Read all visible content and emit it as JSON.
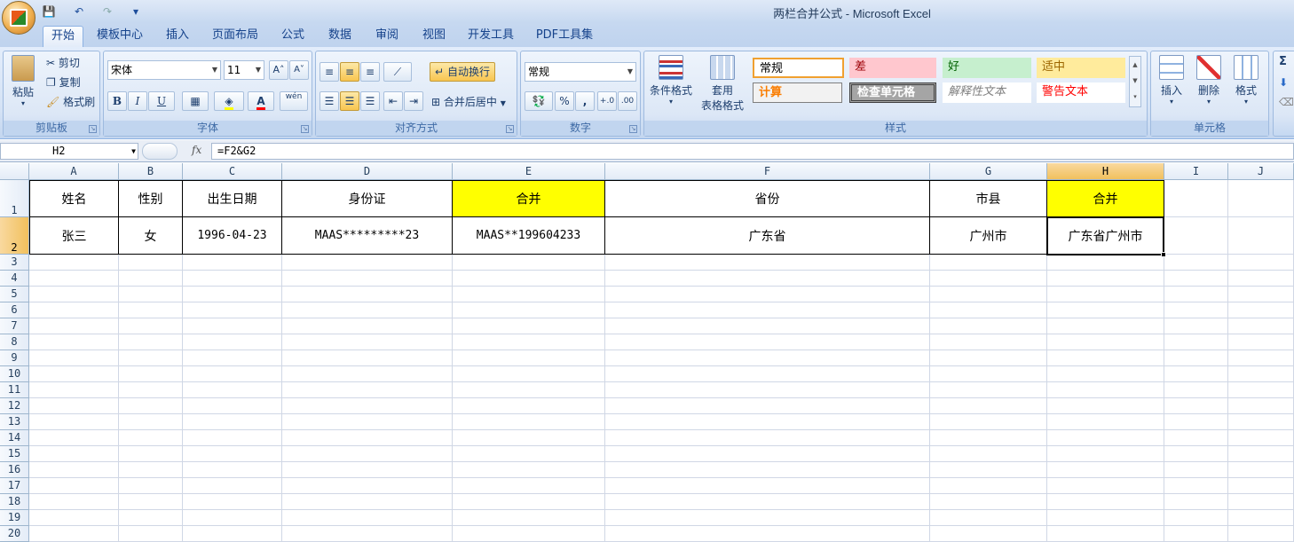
{
  "window": {
    "title": "两栏合并公式 - Microsoft Excel"
  },
  "qat": {
    "save": "💾",
    "undo": "↶",
    "redo": "↷",
    "more": "▾"
  },
  "tabs": [
    "开始",
    "模板中心",
    "插入",
    "页面布局",
    "公式",
    "数据",
    "审阅",
    "视图",
    "开发工具",
    "PDF工具集"
  ],
  "ribbon": {
    "clipboard": {
      "label": "剪贴板",
      "paste": "粘贴",
      "cut": "剪切",
      "copy": "复制",
      "format_painter": "格式刷"
    },
    "font": {
      "label": "字体",
      "name": "宋体",
      "size": "11",
      "bold": "B",
      "italic": "I",
      "underline": "U",
      "grow": "A˄",
      "shrink": "A˅",
      "font_color_glyph": "A",
      "phonetic": "wén"
    },
    "alignment": {
      "label": "对齐方式",
      "wrap": "自动换行",
      "merge": "合并后居中"
    },
    "number": {
      "label": "数字",
      "format": "常规",
      "percent": "%",
      "comma": ",",
      "inc_dec": "+.0",
      "dec_dec": ".00"
    },
    "styles": {
      "label": "样式",
      "conditional": "条件格式",
      "table_format_1": "套用",
      "table_format_2": "表格格式",
      "normal": "常规",
      "bad": "差",
      "good": "好",
      "neutral": "适中",
      "calc": "计算",
      "check": "检查单元格",
      "explanatory": "解释性文本",
      "warning": "警告文本"
    },
    "cells": {
      "label": "单元格",
      "insert": "插入",
      "delete": "删除",
      "format": "格式"
    },
    "editing": {
      "sigma": "Σ"
    }
  },
  "formula_bar": {
    "name_box": "H2",
    "fx": "fx",
    "formula": "=F2&G2"
  },
  "columns": [
    "A",
    "B",
    "C",
    "D",
    "E",
    "F",
    "G",
    "H",
    "I",
    "J"
  ],
  "rows": [
    "1",
    "2",
    "3",
    "4",
    "5",
    "6",
    "7",
    "8",
    "9",
    "10",
    "11",
    "12",
    "13",
    "14",
    "15",
    "16",
    "17",
    "18",
    "19",
    "20"
  ],
  "sheet": {
    "row1": [
      "姓名",
      "性别",
      "出生日期",
      "身份证",
      "合并",
      "省份",
      "市县",
      "合并"
    ],
    "row2": [
      "张三",
      "女",
      "1996-04-23",
      "MAAS*********23",
      "MAAS**199604233",
      "广东省",
      "广州市",
      "广东省广州市"
    ]
  },
  "colors": {
    "highlight": "#ffff00",
    "ribbon_text": "#15428b",
    "bad_bg": "#ffc7ce",
    "bad_fg": "#9c0006",
    "good_bg": "#c6efce",
    "good_fg": "#006100",
    "neutral_bg": "#ffeb9c",
    "neutral_fg": "#9c6500",
    "calc_fg": "#fa7d00",
    "check_bg": "#a5a5a5",
    "warning_fg": "#ff0000"
  }
}
